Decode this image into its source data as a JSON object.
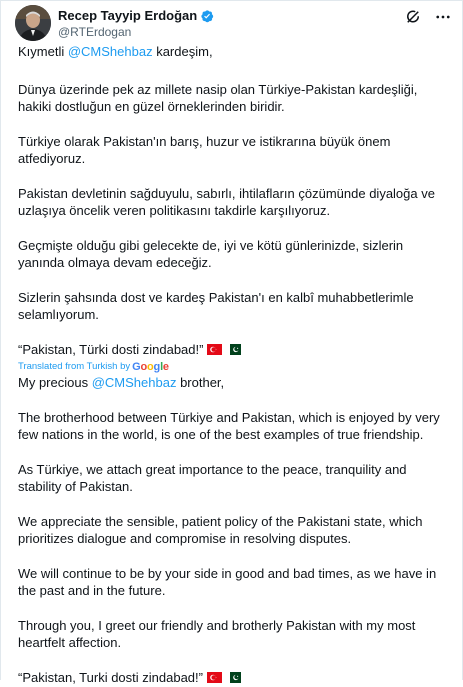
{
  "author": {
    "name": "Recep Tayyip Erdoğan",
    "handle": "@RTErdogan"
  },
  "icons": {
    "verified": "verified-badge-icon",
    "grok": "grok-icon",
    "more": "more-options-icon"
  },
  "colors": {
    "link": "#1d9bf0",
    "text": "#0f1419",
    "muted": "#536471"
  },
  "original": {
    "greeting_prefix": "Kıymetli ",
    "greeting_mention": "@CMShehbaz",
    "greeting_suffix": " kardeşim,",
    "p1": "Dünya üzerinde pek az millete nasip olan Türkiye-Pakistan kardeşliği, hakiki dostluğun en güzel örneklerinden biridir.",
    "p2": "Türkiye olarak Pakistan'ın barış, huzur ve istikrarına büyük önem atfediyoruz.",
    "p3": "Pakistan devletinin sağduyulu, sabırlı, ihtilafların çözümünde diyaloğa ve uzlaşıya öncelik veren politikasını takdirle karşılıyoruz.",
    "p4": "Geçmişte olduğu gibi gelecekte de, iyi ve kötü günlerinizde, sizlerin yanında olmaya devam edeceğiz.",
    "p5": "Sizlerin şahsında dost ve kardeş Pakistan'ı en kalbî muhabbetlerimle selamlıyorum.",
    "closing": "“Pakistan, Türki dosti zindabad!”"
  },
  "translation_label": {
    "prefix": "Translated from Turkish by",
    "brand": "Google"
  },
  "translated": {
    "greeting_prefix": "My precious ",
    "greeting_mention": "@CMShehbaz",
    "greeting_suffix": " brother,",
    "p1": "The brotherhood between Türkiye and Pakistan, which is enjoyed by very few nations in the world, is one of the best examples of true friendship.",
    "p2": "As Türkiye, we attach great importance to the peace, tranquility and stability of Pakistan.",
    "p3": "We appreciate the sensible, patient policy of the Pakistani state, which prioritizes dialogue and compromise in resolving disputes.",
    "p4": "We will continue to be by your side in good and bad times, as we have in the past and in the future.",
    "p5": "Through you, I greet our friendly and brotherly Pakistan with my most heartfelt affection.",
    "closing": "“Pakistan, Turki dosti zindabad!”"
  },
  "flags": {
    "turkey": "turkey-flag-icon",
    "pakistan": "pakistan-flag-icon"
  }
}
